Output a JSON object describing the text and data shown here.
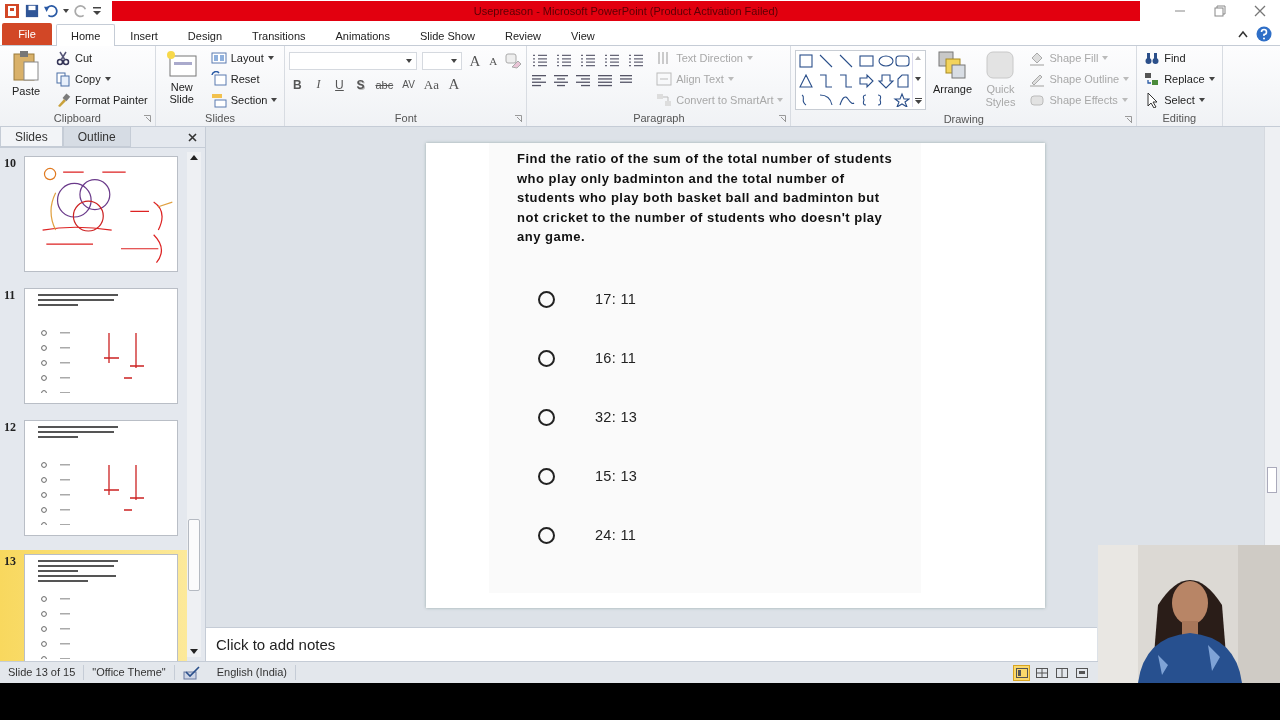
{
  "window": {
    "title": "Usepreason - Microsoft PowerPoint (Product Activation Failed)"
  },
  "file_tab": {
    "label": "File"
  },
  "tabs": [
    {
      "label": "Home",
      "selected": true
    },
    {
      "label": "Insert",
      "selected": false
    },
    {
      "label": "Design",
      "selected": false
    },
    {
      "label": "Transitions",
      "selected": false
    },
    {
      "label": "Animations",
      "selected": false
    },
    {
      "label": "Slide Show",
      "selected": false
    },
    {
      "label": "Review",
      "selected": false
    },
    {
      "label": "View",
      "selected": false
    }
  ],
  "ribbon": {
    "clipboard": {
      "label": "Clipboard",
      "large": {
        "label": "Paste",
        "disabled": false
      },
      "items": [
        {
          "label": "Cut",
          "disabled": false,
          "dropdown": false
        },
        {
          "label": "Copy",
          "disabled": false,
          "dropdown": true
        },
        {
          "label": "Format Painter",
          "disabled": false,
          "dropdown": false
        }
      ]
    },
    "slides": {
      "label": "Slides",
      "large": {
        "label": "New Slide",
        "disabled": false
      },
      "items": [
        {
          "label": "Layout",
          "disabled": false,
          "dropdown": true
        },
        {
          "label": "Reset",
          "disabled": false,
          "dropdown": false
        },
        {
          "label": "Section",
          "disabled": false,
          "dropdown": true
        }
      ]
    },
    "font": {
      "label": "Font",
      "size_tools": [
        "A",
        "A"
      ],
      "format_tools": [
        "B",
        "I",
        "U",
        "S",
        "abc",
        "AV",
        "Aa",
        "A"
      ]
    },
    "paragraph": {
      "label": "Paragraph",
      "items": [
        {
          "label": "Text Direction",
          "disabled": true,
          "dropdown": true
        },
        {
          "label": "Align Text",
          "disabled": true,
          "dropdown": true
        },
        {
          "label": "Convert to SmartArt",
          "disabled": true,
          "dropdown": true
        }
      ]
    },
    "drawing": {
      "label": "Drawing",
      "large": [
        {
          "label": "Arrange",
          "disabled": false
        },
        {
          "label": "Quick Styles",
          "disabled": true
        }
      ],
      "items": [
        {
          "label": "Shape Fill",
          "disabled": true,
          "dropdown": true
        },
        {
          "label": "Shape Outline",
          "disabled": true,
          "dropdown": true
        },
        {
          "label": "Shape Effects",
          "disabled": true,
          "dropdown": true
        }
      ]
    },
    "editing": {
      "label": "Editing",
      "items": [
        {
          "label": "Find",
          "disabled": false,
          "dropdown": false
        },
        {
          "label": "Replace",
          "disabled": false,
          "dropdown": true
        },
        {
          "label": "Select",
          "disabled": false,
          "dropdown": true
        }
      ]
    }
  },
  "panel": {
    "tabs": [
      {
        "label": "Slides",
        "selected": true
      },
      {
        "label": "Outline",
        "selected": false
      }
    ],
    "thumbnails": [
      {
        "number": "10",
        "kind": "diagram",
        "selected": false
      },
      {
        "number": "11",
        "kind": "annotated",
        "selected": false
      },
      {
        "number": "12",
        "kind": "annotated",
        "selected": false
      },
      {
        "number": "13",
        "kind": "question",
        "selected": true
      }
    ]
  },
  "slide": {
    "question": "Find the ratio of the sum of the total number of students who play only badminton and the total number of students who play both basket ball and badminton but not cricket to the number of students who doesn't play any game.",
    "options": [
      {
        "label": "17: 11",
        "selected": false
      },
      {
        "label": "16: 11",
        "selected": false
      },
      {
        "label": "32: 13",
        "selected": false
      },
      {
        "label": "15: 13",
        "selected": false
      },
      {
        "label": "24: 11",
        "selected": false
      }
    ]
  },
  "notes": {
    "placeholder": "Click to add notes"
  },
  "status_bar": {
    "slide": "Slide 13 of 15",
    "theme": "\"Office Theme\"",
    "language": "English (India)",
    "views": [
      {
        "selected": true
      },
      {
        "selected": false
      },
      {
        "selected": false
      },
      {
        "selected": false
      }
    ]
  }
}
